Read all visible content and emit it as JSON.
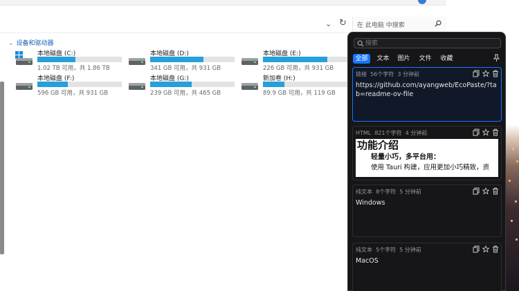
{
  "explorer": {
    "search_placeholder": "在 此电脑 中搜索",
    "section_title": "设备和驱动器",
    "drives": [
      {
        "name": "本地磁盘 (C:)",
        "info": "1.02 TB 可用，共 1.86 TB",
        "fill": 0.45,
        "icon": "windows-drive-icon"
      },
      {
        "name": "本地磁盘 (D:)",
        "info": "341 GB 可用，共 931 GB",
        "fill": 0.63,
        "icon": "drive-icon"
      },
      {
        "name": "本地磁盘 (E:)",
        "info": "226 GB 可用，共 931 GB",
        "fill": 0.76,
        "icon": "drive-icon"
      },
      {
        "name": "本地磁盘 (F:)",
        "info": "596 GB 可用，共 931 GB",
        "fill": 0.36,
        "icon": "drive-icon"
      },
      {
        "name": "本地磁盘 (G:)",
        "info": "239 GB 可用，共 465 GB",
        "fill": 0.49,
        "icon": "drive-icon"
      },
      {
        "name": "新加卷 (H:)",
        "info": "89.9 GB 可用，共 119 GB",
        "fill": 0.25,
        "icon": "drive-icon"
      }
    ],
    "accent": "#26a0da"
  },
  "clipboard": {
    "search_placeholder": "搜索",
    "tabs": [
      "全部",
      "文本",
      "图片",
      "文件",
      "收藏"
    ],
    "active_tab": "全部",
    "accent": "#1677ff",
    "items": [
      {
        "type": "链接",
        "chars": "56个字符",
        "time": "3 分钟前",
        "text": "https://github.com/ayangweb/EcoPaste/?tab=readme-ov-file"
      },
      {
        "type": "HTML",
        "chars": "821个字符",
        "time": "4 分钟前",
        "html_title": "功能介绍",
        "html_subtitle": "轻量小巧，多平台用：",
        "html_para": "使用 Tauri 构建，应用更加小巧精致，资"
      },
      {
        "type": "纯文本",
        "chars": "8个字符",
        "time": "5 分钟前",
        "text": "Windows"
      },
      {
        "type": "纯文本",
        "chars": "5个字符",
        "time": "5 分钟前",
        "text": "MacOS"
      }
    ]
  }
}
